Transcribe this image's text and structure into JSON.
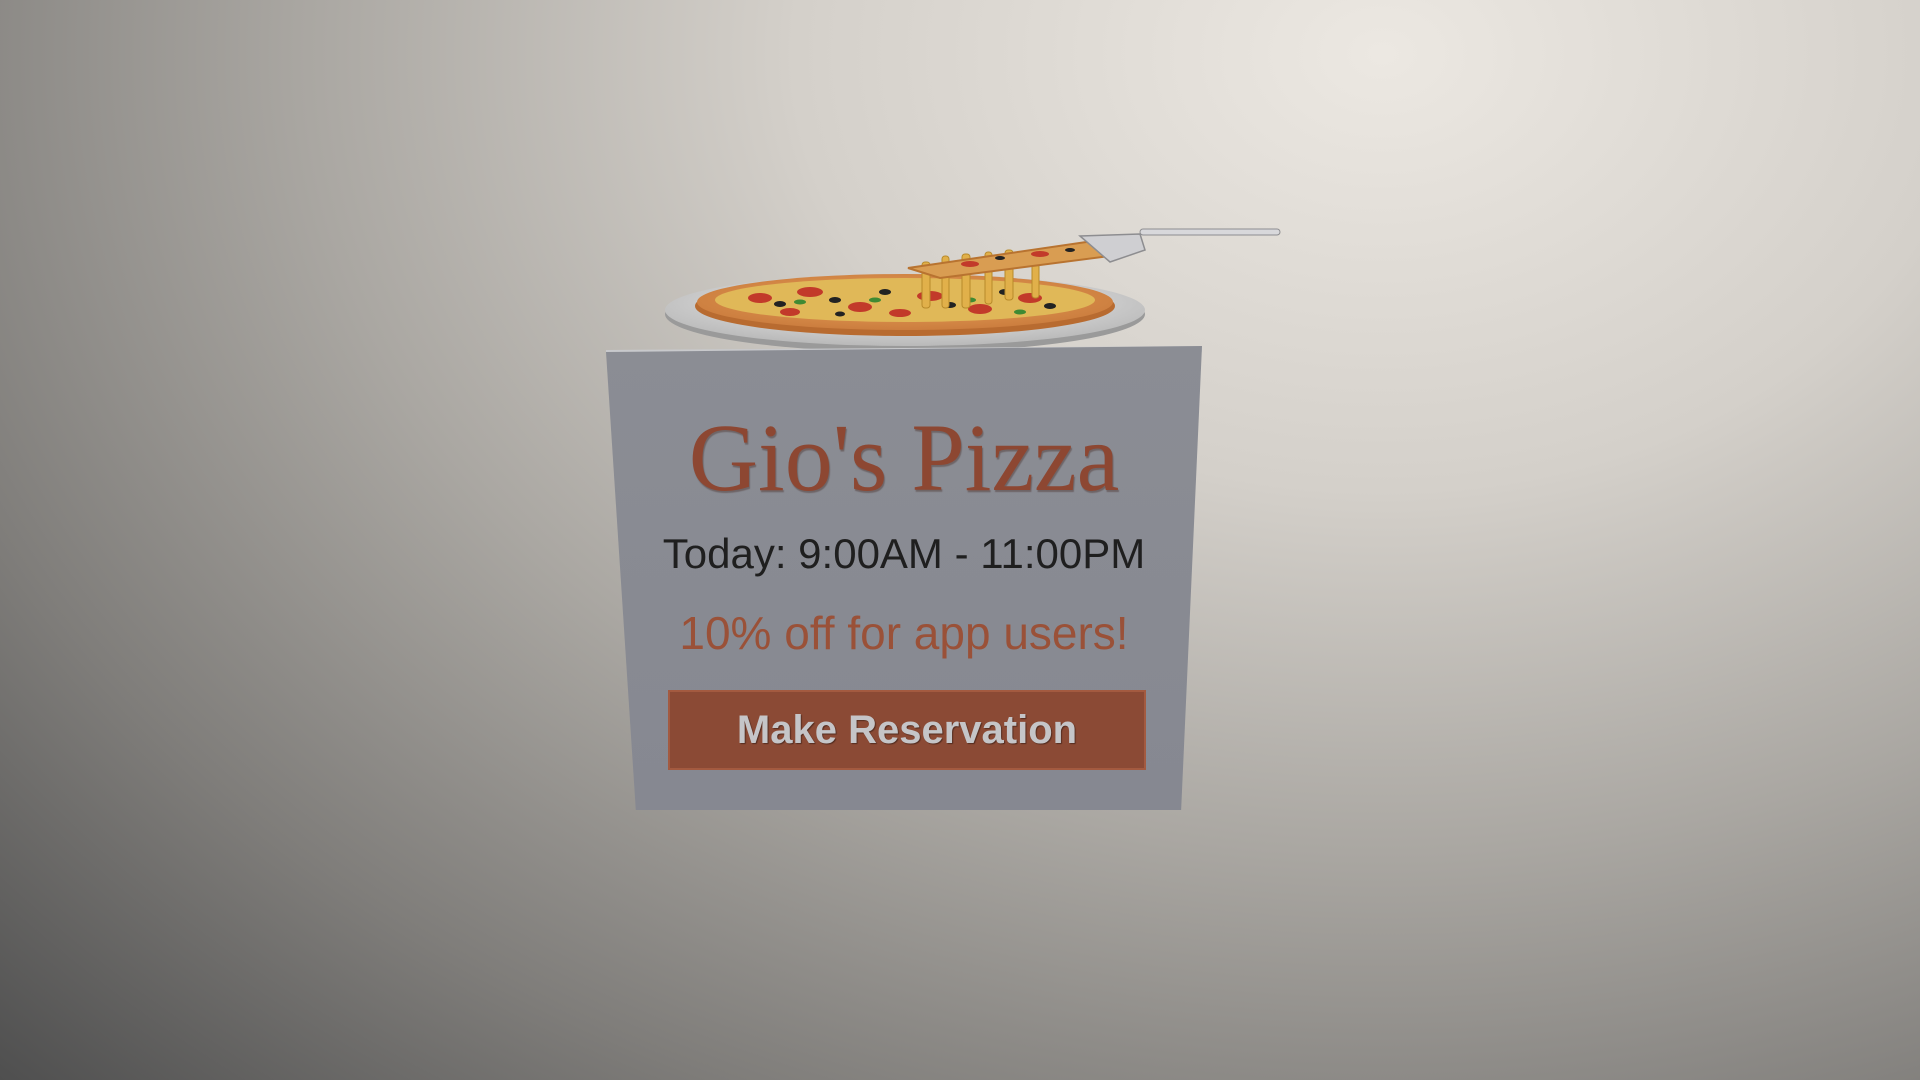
{
  "sign": {
    "title": "Gio's Pizza",
    "hours": "Today: 9:00AM - 11:00PM",
    "promo": "10% off for app users!",
    "button_label": "Make Reservation"
  },
  "colors": {
    "title": "#8d4732",
    "promo": "#9a5138",
    "button_bg": "#8b4a35",
    "panel": "#868891"
  },
  "icons": {
    "pizza_illustration": "pizza-with-server-icon"
  }
}
